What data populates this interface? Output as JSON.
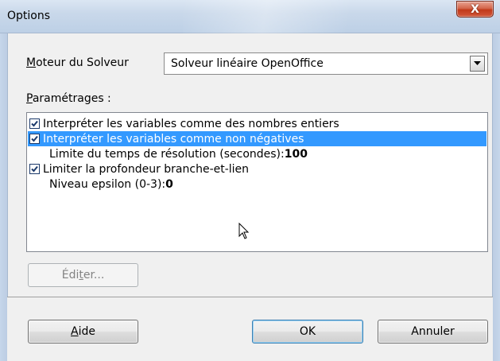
{
  "window": {
    "title": "Options",
    "close_label": "X"
  },
  "engine": {
    "label_mnemonic": "M",
    "label_rest": "oteur du Solveur",
    "selected": "Solveur linéaire OpenOffice"
  },
  "settings": {
    "label_mnemonic": "P",
    "label_rest": "aramétrages :",
    "items": [
      {
        "type": "checkbox",
        "checked": true,
        "text": "Interpréter les variables comme des nombres entiers",
        "selected": false
      },
      {
        "type": "checkbox",
        "checked": true,
        "text": "Interpréter les variables comme non négatives",
        "selected": true
      },
      {
        "type": "value",
        "text": "Limite du temps de résolution (secondes): ",
        "value": "100"
      },
      {
        "type": "checkbox",
        "checked": true,
        "text": "Limiter la profondeur branche-et-lien",
        "selected": false
      },
      {
        "type": "value",
        "text": "Niveau epsilon (0-3): ",
        "value": "0"
      }
    ]
  },
  "buttons": {
    "edit_before": "Édi",
    "edit_mnemonic": "t",
    "edit_after": "er...",
    "help_mnemonic": "A",
    "help_rest": "ide",
    "ok": "OK",
    "cancel": "Annuler"
  },
  "colors": {
    "selection": "#3399ff",
    "checkmark": "#1c3a6b"
  }
}
